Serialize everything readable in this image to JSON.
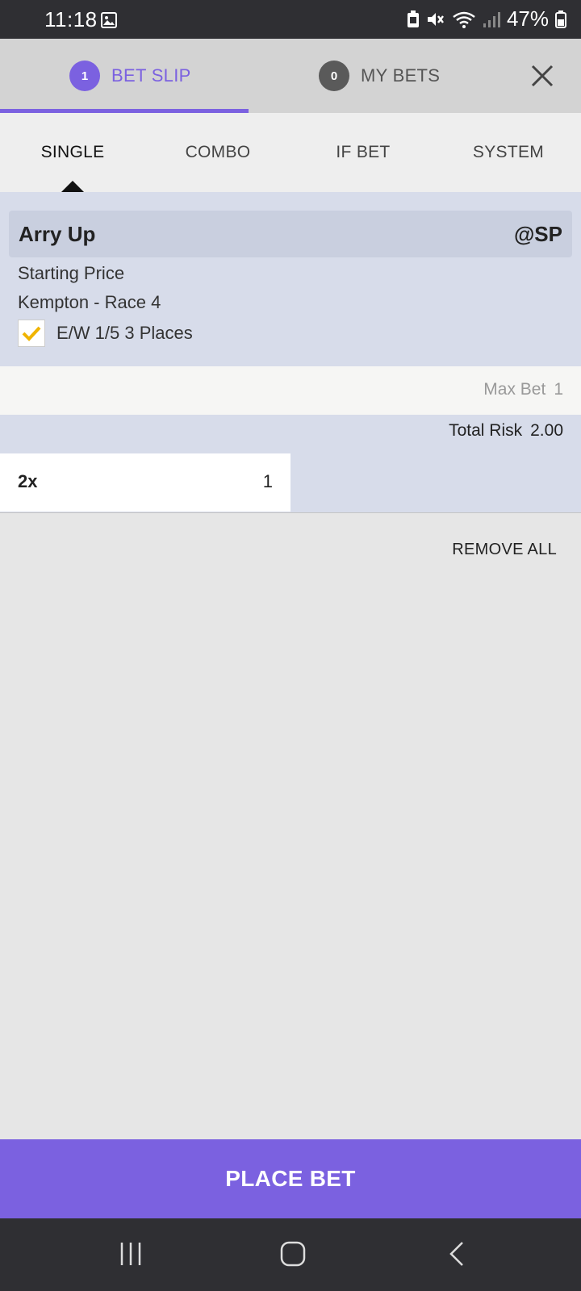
{
  "status_bar": {
    "time": "11:18",
    "battery": "47%",
    "icons": [
      "image-icon",
      "battery-saver-icon",
      "mute-icon",
      "wifi-icon",
      "signal-icon",
      "battery-icon"
    ]
  },
  "header": {
    "tabs": [
      {
        "badge": "1",
        "label": "BET SLIP",
        "active": true
      },
      {
        "badge": "0",
        "label": "MY BETS",
        "active": false
      }
    ],
    "close_icon": "close-icon"
  },
  "bet_types": {
    "tabs": [
      "SINGLE",
      "COMBO",
      "IF BET",
      "SYSTEM"
    ],
    "active": "SINGLE"
  },
  "selection": {
    "name": "Arry Up",
    "odds": "@SP",
    "price_type": "Starting Price",
    "event": "Kempton - Race 4",
    "each_way": {
      "checked": true,
      "label": "E/W 1/5 3 Places"
    }
  },
  "limits": {
    "max_bet_label": "Max Bet",
    "max_bet_value": "1",
    "total_risk_label": "Total Risk",
    "total_risk_value": "2.00"
  },
  "stake": {
    "multiplier": "2x",
    "value": "1"
  },
  "actions": {
    "remove_all": "REMOVE ALL",
    "place_bet": "PLACE BET"
  },
  "colors": {
    "accent": "#7b61e0",
    "check": "#f0b400",
    "card_bg": "#d7dcea"
  }
}
